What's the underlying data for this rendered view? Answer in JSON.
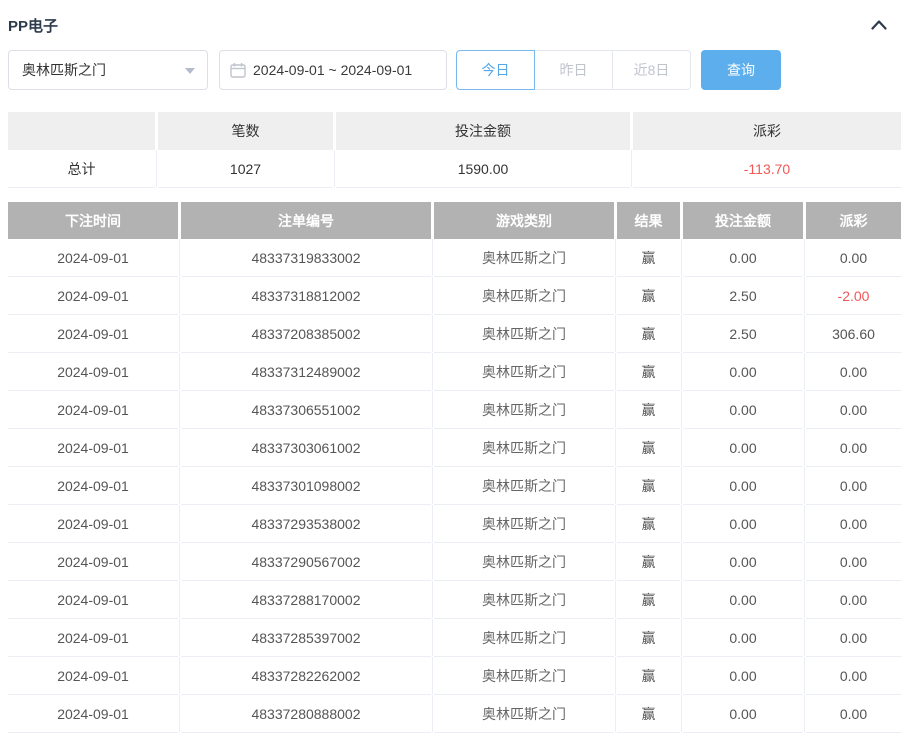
{
  "panel": {
    "title": "PP电子",
    "collapse_icon": "chevron-up"
  },
  "filters": {
    "game_select": {
      "value": "奥林匹斯之门",
      "icon": "caret-down"
    },
    "date_range": {
      "value": "2024-09-01 ~ 2024-09-01",
      "icon": "calendar"
    },
    "quick_ranges": [
      {
        "label": "今日",
        "active": true
      },
      {
        "label": "昨日",
        "active": false
      },
      {
        "label": "近8日",
        "active": false
      }
    ],
    "search_label": "查询"
  },
  "summary": {
    "headers": [
      "",
      "笔数",
      "投注金额",
      "派彩"
    ],
    "total": {
      "label": "总计",
      "count": "1027",
      "bet_amount": "1590.00",
      "payout": "-113.70"
    }
  },
  "table": {
    "headers": [
      "下注时间",
      "注单编号",
      "游戏类别",
      "结果",
      "投注金额",
      "派彩"
    ],
    "rows": [
      [
        "2024-09-01",
        "48337319833002",
        "奥林匹斯之门",
        "赢",
        "0.00",
        "0.00"
      ],
      [
        "2024-09-01",
        "48337318812002",
        "奥林匹斯之门",
        "赢",
        "2.50",
        "-2.00"
      ],
      [
        "2024-09-01",
        "48337208385002",
        "奥林匹斯之门",
        "赢",
        "2.50",
        "306.60"
      ],
      [
        "2024-09-01",
        "48337312489002",
        "奥林匹斯之门",
        "赢",
        "0.00",
        "0.00"
      ],
      [
        "2024-09-01",
        "48337306551002",
        "奥林匹斯之门",
        "赢",
        "0.00",
        "0.00"
      ],
      [
        "2024-09-01",
        "48337303061002",
        "奥林匹斯之门",
        "赢",
        "0.00",
        "0.00"
      ],
      [
        "2024-09-01",
        "48337301098002",
        "奥林匹斯之门",
        "赢",
        "0.00",
        "0.00"
      ],
      [
        "2024-09-01",
        "48337293538002",
        "奥林匹斯之门",
        "赢",
        "0.00",
        "0.00"
      ],
      [
        "2024-09-01",
        "48337290567002",
        "奥林匹斯之门",
        "赢",
        "0.00",
        "0.00"
      ],
      [
        "2024-09-01",
        "48337288170002",
        "奥林匹斯之门",
        "赢",
        "0.00",
        "0.00"
      ],
      [
        "2024-09-01",
        "48337285397002",
        "奥林匹斯之门",
        "赢",
        "0.00",
        "0.00"
      ],
      [
        "2024-09-01",
        "48337282262002",
        "奥林匹斯之门",
        "赢",
        "0.00",
        "0.00"
      ],
      [
        "2024-09-01",
        "48337280888002",
        "奥林匹斯之门",
        "赢",
        "0.00",
        "0.00"
      ]
    ]
  },
  "colors": {
    "accent_blue": "#5caeed",
    "active_tab_blue": "#55a7e8",
    "negative_red": "#f25757",
    "table_header_gray": "#b2b2b2",
    "summary_header_gray": "#efefef"
  }
}
